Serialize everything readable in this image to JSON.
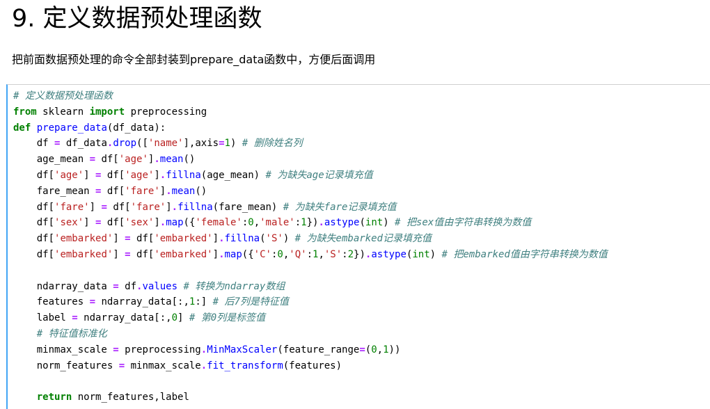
{
  "heading": "9. 定义数据预处理函数",
  "description": "把前面数据预处理的命令全部封装到prepare_data函数中，方便后面调用",
  "code_lines": [
    [
      [
        "cm",
        "# 定义数据预处理函数"
      ]
    ],
    [
      [
        "kw",
        "from"
      ],
      [
        "id",
        " sklearn "
      ],
      [
        "kw",
        "import"
      ],
      [
        "id",
        " preprocessing"
      ]
    ],
    [
      [
        "kw",
        "def"
      ],
      [
        "id",
        " "
      ],
      [
        "fn",
        "prepare_data"
      ],
      [
        "id",
        "(df_data):"
      ]
    ],
    [
      [
        "id",
        "    df "
      ],
      [
        "op",
        "="
      ],
      [
        "id",
        " df_data"
      ],
      [
        "op",
        "."
      ],
      [
        "attr",
        "drop"
      ],
      [
        "id",
        "(["
      ],
      [
        "str",
        "'name'"
      ],
      [
        "id",
        "],axis"
      ],
      [
        "op",
        "="
      ],
      [
        "num",
        "1"
      ],
      [
        "id",
        ") "
      ],
      [
        "cm",
        "# 删除姓名列"
      ]
    ],
    [
      [
        "id",
        "    age_mean "
      ],
      [
        "op",
        "="
      ],
      [
        "id",
        " df["
      ],
      [
        "str",
        "'age'"
      ],
      [
        "id",
        "]"
      ],
      [
        "op",
        "."
      ],
      [
        "attr",
        "mean"
      ],
      [
        "id",
        "()"
      ]
    ],
    [
      [
        "id",
        "    df["
      ],
      [
        "str",
        "'age'"
      ],
      [
        "id",
        "] "
      ],
      [
        "op",
        "="
      ],
      [
        "id",
        " df["
      ],
      [
        "str",
        "'age'"
      ],
      [
        "id",
        "]"
      ],
      [
        "op",
        "."
      ],
      [
        "attr",
        "fillna"
      ],
      [
        "id",
        "(age_mean) "
      ],
      [
        "cm",
        "# 为缺失age记录填充值"
      ]
    ],
    [
      [
        "id",
        "    fare_mean "
      ],
      [
        "op",
        "="
      ],
      [
        "id",
        " df["
      ],
      [
        "str",
        "'fare'"
      ],
      [
        "id",
        "]"
      ],
      [
        "op",
        "."
      ],
      [
        "attr",
        "mean"
      ],
      [
        "id",
        "()"
      ]
    ],
    [
      [
        "id",
        "    df["
      ],
      [
        "str",
        "'fare'"
      ],
      [
        "id",
        "] "
      ],
      [
        "op",
        "="
      ],
      [
        "id",
        " df["
      ],
      [
        "str",
        "'fare'"
      ],
      [
        "id",
        "]"
      ],
      [
        "op",
        "."
      ],
      [
        "attr",
        "fillna"
      ],
      [
        "id",
        "(fare_mean) "
      ],
      [
        "cm",
        "# 为缺失fare记录填充值"
      ]
    ],
    [
      [
        "id",
        "    df["
      ],
      [
        "str",
        "'sex'"
      ],
      [
        "id",
        "] "
      ],
      [
        "op",
        "="
      ],
      [
        "id",
        " df["
      ],
      [
        "str",
        "'sex'"
      ],
      [
        "id",
        "]"
      ],
      [
        "op",
        "."
      ],
      [
        "attr",
        "map"
      ],
      [
        "id",
        "({"
      ],
      [
        "str",
        "'female'"
      ],
      [
        "id",
        ":"
      ],
      [
        "num",
        "0"
      ],
      [
        "id",
        ","
      ],
      [
        "str",
        "'male'"
      ],
      [
        "id",
        ":"
      ],
      [
        "num",
        "1"
      ],
      [
        "id",
        "})"
      ],
      [
        "op",
        "."
      ],
      [
        "attr",
        "astype"
      ],
      [
        "id",
        "("
      ],
      [
        "bi",
        "int"
      ],
      [
        "id",
        ") "
      ],
      [
        "cm",
        "# 把sex值由字符串转换为数值"
      ]
    ],
    [
      [
        "id",
        "    df["
      ],
      [
        "str",
        "'embarked'"
      ],
      [
        "id",
        "] "
      ],
      [
        "op",
        "="
      ],
      [
        "id",
        " df["
      ],
      [
        "str",
        "'embarked'"
      ],
      [
        "id",
        "]"
      ],
      [
        "op",
        "."
      ],
      [
        "attr",
        "fillna"
      ],
      [
        "id",
        "("
      ],
      [
        "str",
        "'S'"
      ],
      [
        "id",
        ") "
      ],
      [
        "cm",
        "# 为缺失embarked记录填充值"
      ]
    ],
    [
      [
        "id",
        "    df["
      ],
      [
        "str",
        "'embarked'"
      ],
      [
        "id",
        "] "
      ],
      [
        "op",
        "="
      ],
      [
        "id",
        " df["
      ],
      [
        "str",
        "'embarked'"
      ],
      [
        "id",
        "]"
      ],
      [
        "op",
        "."
      ],
      [
        "attr",
        "map"
      ],
      [
        "id",
        "({"
      ],
      [
        "str",
        "'C'"
      ],
      [
        "id",
        ":"
      ],
      [
        "num",
        "0"
      ],
      [
        "id",
        ","
      ],
      [
        "str",
        "'Q'"
      ],
      [
        "id",
        ":"
      ],
      [
        "num",
        "1"
      ],
      [
        "id",
        ","
      ],
      [
        "str",
        "'S'"
      ],
      [
        "id",
        ":"
      ],
      [
        "num",
        "2"
      ],
      [
        "id",
        "})"
      ],
      [
        "op",
        "."
      ],
      [
        "attr",
        "astype"
      ],
      [
        "id",
        "("
      ],
      [
        "bi",
        "int"
      ],
      [
        "id",
        ") "
      ],
      [
        "cm",
        "# 把embarked值由字符串转换为数值"
      ]
    ],
    [],
    [
      [
        "id",
        "    ndarray_data "
      ],
      [
        "op",
        "="
      ],
      [
        "id",
        " df"
      ],
      [
        "op",
        "."
      ],
      [
        "attr",
        "values"
      ],
      [
        "id",
        " "
      ],
      [
        "cm",
        "# 转换为ndarray数组"
      ]
    ],
    [
      [
        "id",
        "    features "
      ],
      [
        "op",
        "="
      ],
      [
        "id",
        " ndarray_data[:,"
      ],
      [
        "num",
        "1"
      ],
      [
        "id",
        ":] "
      ],
      [
        "cm",
        "# 后7列是特征值"
      ]
    ],
    [
      [
        "id",
        "    label "
      ],
      [
        "op",
        "="
      ],
      [
        "id",
        " ndarray_data[:,"
      ],
      [
        "num",
        "0"
      ],
      [
        "id",
        "] "
      ],
      [
        "cm",
        "# 第0列是标签值"
      ]
    ],
    [
      [
        "id",
        "    "
      ],
      [
        "cm",
        "# 特征值标准化"
      ]
    ],
    [
      [
        "id",
        "    minmax_scale "
      ],
      [
        "op",
        "="
      ],
      [
        "id",
        " preprocessing"
      ],
      [
        "op",
        "."
      ],
      [
        "attr",
        "MinMaxScaler"
      ],
      [
        "id",
        "(feature_range"
      ],
      [
        "op",
        "="
      ],
      [
        "id",
        "("
      ],
      [
        "num",
        "0"
      ],
      [
        "id",
        ","
      ],
      [
        "num",
        "1"
      ],
      [
        "id",
        "))"
      ]
    ],
    [
      [
        "id",
        "    norm_features "
      ],
      [
        "op",
        "="
      ],
      [
        "id",
        " minmax_scale"
      ],
      [
        "op",
        "."
      ],
      [
        "attr",
        "fit_transform"
      ],
      [
        "id",
        "(features)"
      ]
    ],
    [],
    [
      [
        "id",
        "    "
      ],
      [
        "kw",
        "return"
      ],
      [
        "id",
        " norm_features,label"
      ]
    ]
  ]
}
